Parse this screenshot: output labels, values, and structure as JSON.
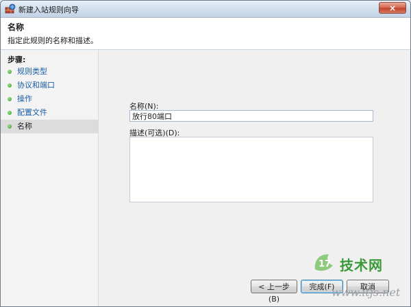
{
  "window": {
    "title": "新建入站规则向导",
    "close_symbol": "×"
  },
  "header": {
    "title": "名称",
    "description": "指定此规则的名称和描述。"
  },
  "steps": {
    "heading": "步骤:",
    "items": [
      {
        "label": "规则类型",
        "current": false
      },
      {
        "label": "协议和端口",
        "current": false
      },
      {
        "label": "操作",
        "current": false
      },
      {
        "label": "配置文件",
        "current": false
      },
      {
        "label": "名称",
        "current": true
      }
    ]
  },
  "form": {
    "name_label": "名称(N):",
    "name_value": "放行80端口",
    "description_label": "描述(可选)(D):",
    "description_value": ""
  },
  "buttons": {
    "back": "< 上一步(B)",
    "finish": "完成(F)",
    "cancel": "取消"
  },
  "watermark": {
    "logo_text": "17",
    "site_name": "技术网",
    "url": "www.itjs.net"
  },
  "colors": {
    "link": "#1a5ea8",
    "step_dot": "#2f9a1e",
    "watermark_green": "#3a9a3a"
  }
}
